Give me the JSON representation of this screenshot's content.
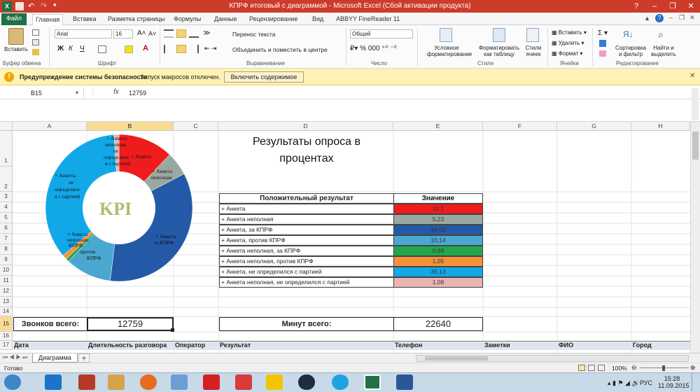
{
  "window": {
    "title": "КПРФ итоговый с диаграммой - Microsoft Excel (Сбой активации продукта)"
  },
  "tabs": [
    "Файл",
    "Главная",
    "Вставка",
    "Разметка страницы",
    "Формулы",
    "Данные",
    "Рецензирование",
    "Вид",
    "ABBYY FineReader 11"
  ],
  "ribbon": {
    "paste": "Вставить",
    "clipboard_group": "Буфер обмена",
    "font_name": "Arial",
    "font_size": "16",
    "font_group": "Шрифт",
    "wrap_text": "Перенос текста",
    "merge_center": "Объединить и поместить в центре",
    "align_group": "Выравнивание",
    "number_format": "Общий",
    "number_group": "Число",
    "cond_format_1": "Условное",
    "cond_format_2": "форматирование",
    "format_table_1": "Форматировать",
    "format_table_2": "как таблицу",
    "cell_styles_1": "Стили",
    "cell_styles_2": "ячеек",
    "styles_group": "Стили",
    "insert": "Вставить",
    "delete": "Удалить",
    "format": "Формат",
    "cells_group": "Ячейки",
    "sort_1": "Сортировка",
    "sort_2": "и фильтр",
    "find_1": "Найти и",
    "find_2": "выделить",
    "editing_group": "Редактирование"
  },
  "security": {
    "title": "Предупреждение системы безопасности",
    "message": "Запуск макросов отключен.",
    "button": "Включить содержимое"
  },
  "formula_bar": {
    "name_box": "B15",
    "fx": "fx",
    "value": "12759"
  },
  "columns": [
    "A",
    "B",
    "C",
    "D",
    "E",
    "F",
    "G",
    "H"
  ],
  "rows": [
    "1",
    "2",
    "3",
    "4",
    "5",
    "6",
    "7",
    "8",
    "9",
    "10",
    "11",
    "12",
    "13",
    "14",
    "15",
    "16",
    "17"
  ],
  "sheet": {
    "heading_line1": "Результаты опроса в",
    "heading_line2": "процентах",
    "table_header": [
      "Положительный результат",
      "Значение"
    ],
    "table_rows": [
      {
        "label": "+ Анкета",
        "value": "12,1",
        "color": "#ee1c1c"
      },
      {
        "label": "+ Анкета неполная",
        "value": "5,23",
        "color": "#9aa8a0"
      },
      {
        "label": "+ Анкета, за КПРФ",
        "value": "34,59",
        "color": "#2459a8"
      },
      {
        "label": "+ Анкета, против КПРФ",
        "value": "10,14",
        "color": "#4aa8d0"
      },
      {
        "label": "+ Анкета неполная, за КПРФ",
        "value": "0,68",
        "color": "#22a84a"
      },
      {
        "label": "+ Анкета неполная, против КПРФ",
        "value": "1,05",
        "color": "#f5923a"
      },
      {
        "label": "+ Анкета, не определился с партией",
        "value": "35,13",
        "color": "#12a8e8"
      },
      {
        "label": "+ Анкета неполная, не определился с партией",
        "value": "1,08",
        "color": "#e8b4b4"
      }
    ],
    "calls_label": "Звонков всего:",
    "calls_value": "12759",
    "minutes_label": "Минут всего:",
    "minutes_value": "22640",
    "row17": [
      "Дата",
      "Длительность разговора",
      "Оператор",
      "Результат",
      "Телефон",
      "Заметки",
      "ФИО",
      "Город"
    ]
  },
  "chart_data": {
    "type": "pie",
    "donut": true,
    "center_text": "KPI",
    "categories": [
      "+ Анкета",
      "+ Анкета неполная",
      "+ Анкета, за КПРФ",
      "+ Анкета, против КПРФ",
      "+ Анкета неполная, за КПРФ",
      "+ Анкета неполная, против КПРФ",
      "+ Анкета, не определился с партией",
      "+ Анкета неполная, не определился с партией"
    ],
    "values": [
      12.1,
      5.23,
      34.59,
      10.14,
      0.68,
      1.05,
      35.13,
      1.08
    ],
    "colors": [
      "#ee1c1c",
      "#9aa8a0",
      "#2459a8",
      "#4aa8d0",
      "#22a84a",
      "#f5923a",
      "#12a8e8",
      "#e8b4b4"
    ]
  },
  "sheet_tab": "Диаграмма",
  "status": {
    "ready": "Готово",
    "zoom": "100%"
  },
  "tray": {
    "lang": "РУС",
    "time": "15:28",
    "date": "11.09.2015"
  }
}
